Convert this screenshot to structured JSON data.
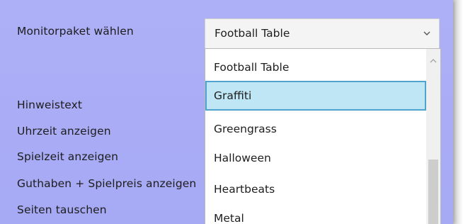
{
  "form": {
    "labels": {
      "monitor_package": "Monitorpaket wählen",
      "hint_text": "Hinweistext",
      "show_time": "Uhrzeit anzeigen",
      "show_playtime": "Spielzeit anzeigen",
      "show_credit_price": "Guthaben + Spielpreis anzeigen",
      "swap_sides": "Seiten tauschen"
    },
    "monitor_package_select": {
      "selected_value": "Football Table",
      "chevron_icon": "chevron-down-icon",
      "options": [
        {
          "label": "Football Table",
          "state": "normal"
        },
        {
          "label": "Graffiti",
          "state": "highlighted"
        },
        {
          "label": "Greengrass",
          "state": "normal"
        },
        {
          "label": "Halloween",
          "state": "normal"
        },
        {
          "label": "Heartbeats",
          "state": "normal"
        },
        {
          "label": "Metal",
          "state": "normal"
        }
      ],
      "scrollbar": {
        "up_icon": "chevron-up-icon"
      }
    }
  },
  "colors": {
    "panel_background": "#a9acf5",
    "highlight_fill": "#bee6f5",
    "highlight_border": "#4ea3cf"
  }
}
